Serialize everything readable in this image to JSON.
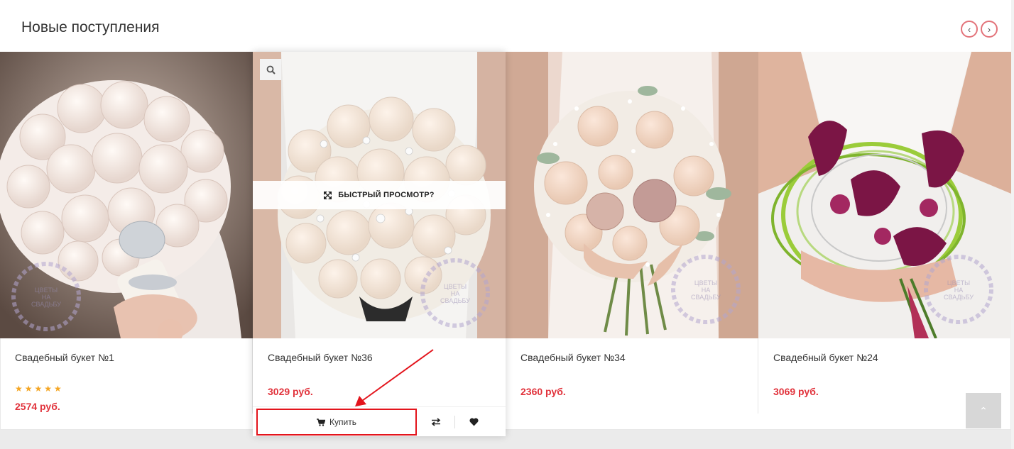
{
  "section": {
    "title": "Новые поступления",
    "nav_prev_icon": "chevron-left-icon",
    "nav_next_icon": "chevron-right-icon",
    "nav_prev_glyph": "‹",
    "nav_next_glyph": "›"
  },
  "colors": {
    "price": "#e1323b",
    "accent_border": "#e3141c",
    "nav_border": "#e3737a",
    "stars": "#f5a623"
  },
  "products": [
    {
      "name": "Свадебный букет №1",
      "rating": 5,
      "stars": "★★★★★",
      "price": "2574 руб."
    },
    {
      "name": "Свадебный букет №36",
      "price": "3029 руб."
    },
    {
      "name": "Свадебный букет №34",
      "price": "2360 руб."
    },
    {
      "name": "Свадебный букет №24",
      "price": "3069 руб."
    }
  ],
  "hover_card": {
    "quick_view_label": "БЫСТРЫЙ ПРОСМОТР?",
    "quick_view_icon": "expand-icon",
    "zoom_icon": "search-icon",
    "buy_label": "Купить",
    "buy_icon": "cart-icon",
    "compare_icon": "compare-icon",
    "wishlist_icon": "heart-icon"
  },
  "watermark": {
    "line1": "ЦВЕТЫ",
    "line2": "НА",
    "line3": "СВАДЬБУ"
  },
  "scroll_top": {
    "icon": "chevron-up-icon",
    "glyph": "⌃"
  }
}
